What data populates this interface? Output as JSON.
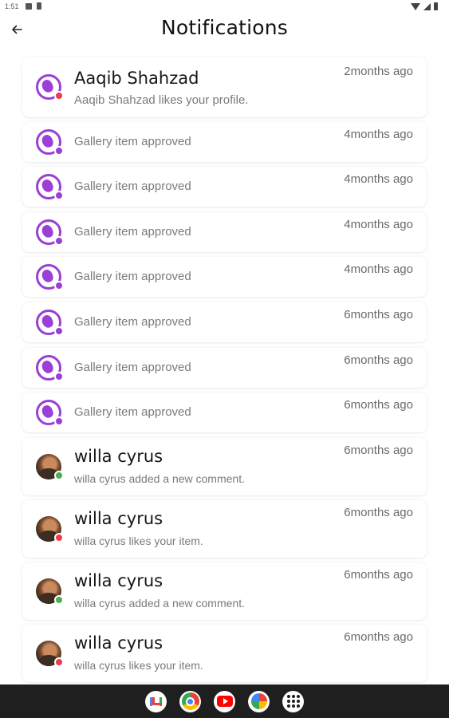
{
  "status_bar": {
    "time": "1:51"
  },
  "header": {
    "title": "Notifications"
  },
  "notifications": [
    {
      "avatar": "app-logo-icon",
      "badge": "red",
      "title": "Aaqib Shahzad",
      "message": "Aaqib Shahzad likes your profile.",
      "time": "2months ago"
    },
    {
      "avatar": "app-logo-icon",
      "badge": "purple",
      "title": "",
      "message": "Gallery item approved",
      "time": "4months ago"
    },
    {
      "avatar": "app-logo-icon",
      "badge": "purple",
      "title": "",
      "message": "Gallery item approved",
      "time": "4months ago"
    },
    {
      "avatar": "app-logo-icon",
      "badge": "purple",
      "title": "",
      "message": "Gallery item approved",
      "time": "4months ago"
    },
    {
      "avatar": "app-logo-icon",
      "badge": "purple",
      "title": "",
      "message": "Gallery item approved",
      "time": "4months ago"
    },
    {
      "avatar": "app-logo-icon",
      "badge": "purple",
      "title": "",
      "message": "Gallery item approved",
      "time": "6months ago"
    },
    {
      "avatar": "app-logo-icon",
      "badge": "purple",
      "title": "",
      "message": "Gallery item approved",
      "time": "6months ago"
    },
    {
      "avatar": "app-logo-icon",
      "badge": "purple",
      "title": "",
      "message": "Gallery item approved",
      "time": "6months ago"
    },
    {
      "avatar": "user-photo",
      "badge": "green",
      "title": "willa cyrus",
      "message": "willa cyrus added a new comment.",
      "time": "6months ago"
    },
    {
      "avatar": "user-photo",
      "badge": "red",
      "title": "willa cyrus",
      "message": "willa cyrus likes your item.",
      "time": "6months ago"
    },
    {
      "avatar": "user-photo",
      "badge": "green",
      "title": "willa cyrus",
      "message": "willa cyrus added a new comment.",
      "time": "6months ago"
    },
    {
      "avatar": "user-photo",
      "badge": "red",
      "title": "willa cyrus",
      "message": "willa cyrus likes your item.",
      "time": "6months ago"
    }
  ],
  "nav_bar": {
    "apps": [
      "gmail-icon",
      "chrome-icon",
      "youtube-icon",
      "photos-icon",
      "app-drawer-icon"
    ]
  },
  "colors": {
    "accent": "#9b3fd6",
    "like_badge": "#ef3a4a",
    "comment_badge": "#4caf50"
  }
}
